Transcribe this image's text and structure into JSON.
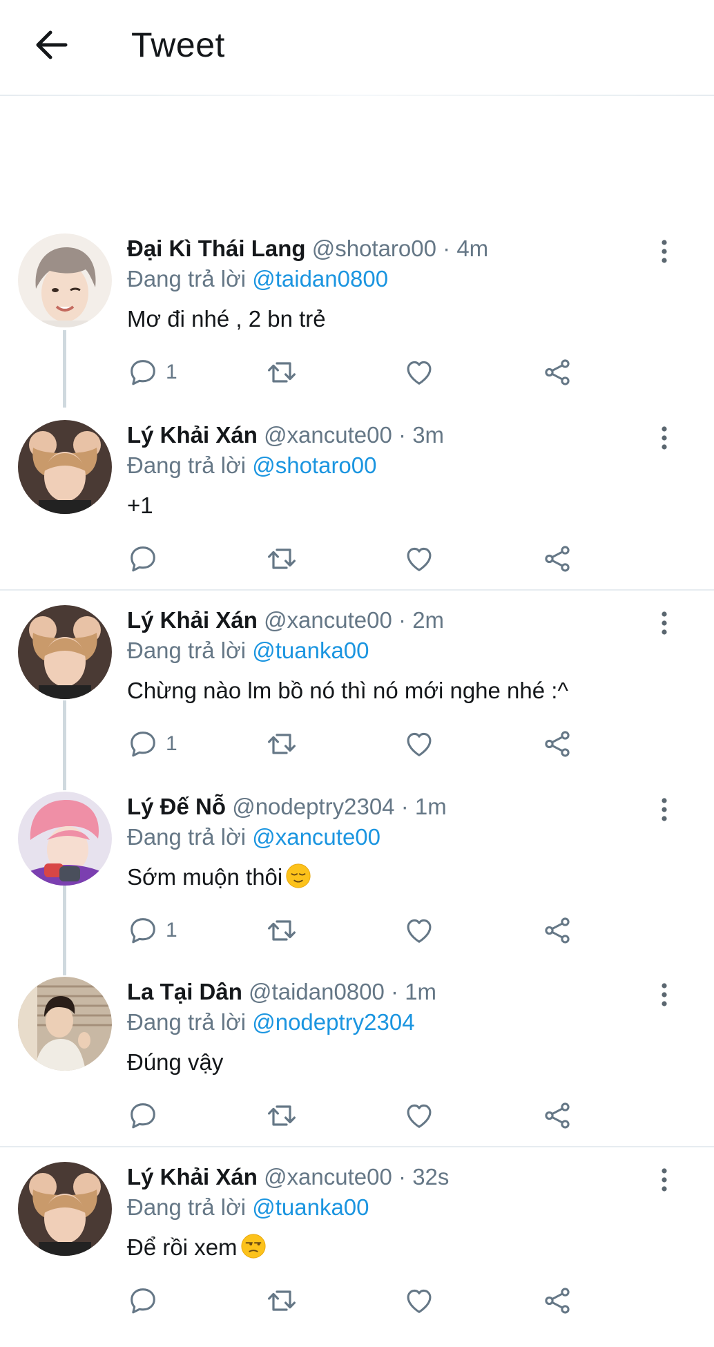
{
  "header": {
    "title": "Tweet"
  },
  "tweets": [
    {
      "name": "Đại Kì Thái Lang",
      "handle": "@shotaro00",
      "time": "· 4m",
      "reply_prefix": "Đang trả lời",
      "reply_to": "@taidan0800",
      "text": "Mơ đi nhé , 2 bn trẻ",
      "reply_count": "1"
    },
    {
      "name": "Lý Khải Xán",
      "handle": "@xancute00",
      "time": "· 3m",
      "reply_prefix": "Đang trả lời",
      "reply_to": "@shotaro00",
      "text": "+1",
      "reply_count": ""
    },
    {
      "name": "Lý Khải Xán",
      "handle": "@xancute00",
      "time": "· 2m",
      "reply_prefix": "Đang trả lời",
      "reply_to": "@tuanka00",
      "text": "Chừng nào lm bồ nó thì nó mới nghe nhé :^",
      "reply_count": "1"
    },
    {
      "name": "Lý Đế Nỗ",
      "handle": "@nodeptry2304",
      "time": "· 1m",
      "reply_prefix": "Đang trả lời",
      "reply_to": "@xancute00",
      "text": "Sớm muộn thôi",
      "emoji": "relieved-face-emoji",
      "reply_count": "1"
    },
    {
      "name": "La Tại Dân",
      "handle": "@taidan0800",
      "time": "· 1m",
      "reply_prefix": "Đang trả lời",
      "reply_to": "@nodeptry2304",
      "text": "Đúng vậy",
      "reply_count": ""
    },
    {
      "name": "Lý Khải Xán",
      "handle": "@xancute00",
      "time": "· 32s",
      "reply_prefix": "Đang trả lời",
      "reply_to": "@tuanka00",
      "text": "Để rồi xem",
      "emoji": "unamused-face-emoji",
      "reply_count": ""
    }
  ],
  "icons": {
    "back": "arrow-left-icon",
    "menu": "more-vertical-icon",
    "reply": "comment-icon",
    "retweet": "retweet-icon",
    "like": "heart-icon",
    "share": "share-icon"
  },
  "colors": {
    "link": "#1b95e0",
    "secondary": "#657786",
    "text": "#14171a",
    "divider": "#e6ecf0"
  }
}
